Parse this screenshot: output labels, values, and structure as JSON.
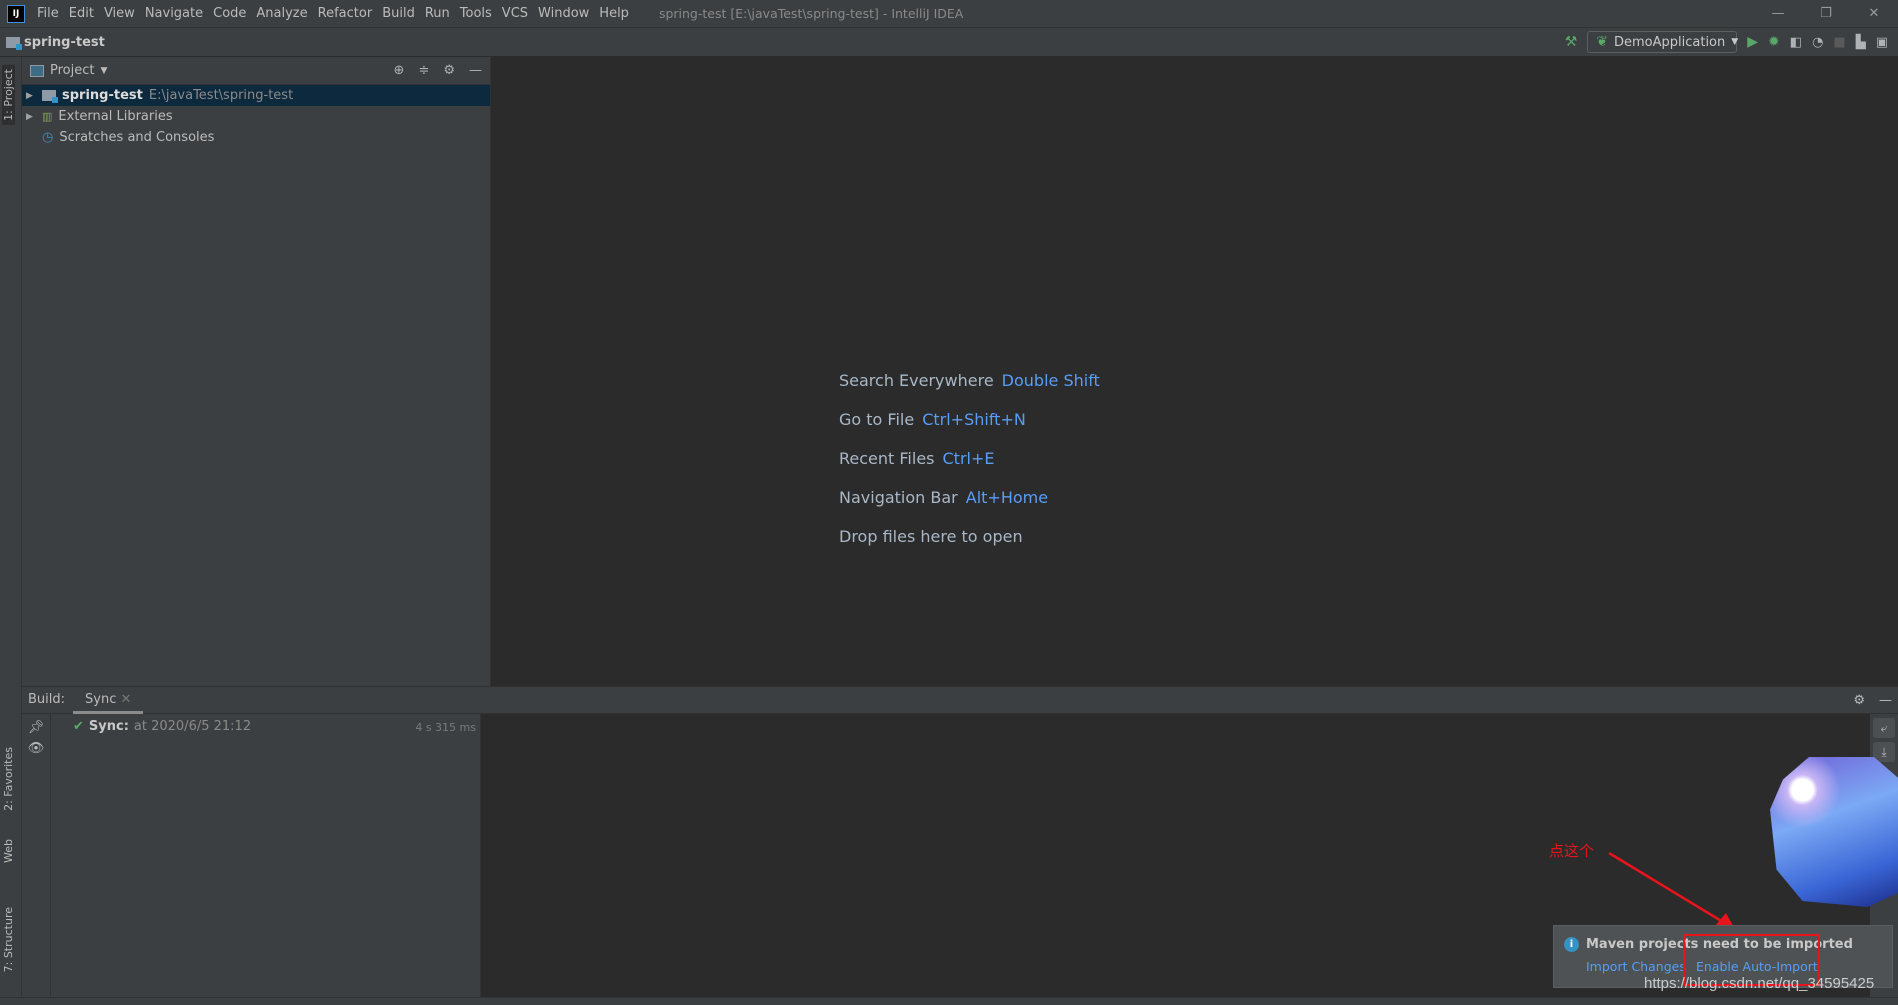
{
  "window": {
    "title": "spring-test [E:\\javaTest\\spring-test] - IntelliJ IDEA",
    "logo": "IJ"
  },
  "menu": [
    "File",
    "Edit",
    "View",
    "Navigate",
    "Code",
    "Analyze",
    "Refactor",
    "Build",
    "Run",
    "Tools",
    "VCS",
    "Window",
    "Help"
  ],
  "navbar": {
    "project": "spring-test",
    "run_config": "DemoApplication"
  },
  "left_tabs": {
    "project": "1: Project",
    "favorites": "2: Favorites",
    "web": "Web",
    "structure": "7: Structure"
  },
  "project_panel": {
    "title": "Project",
    "items": [
      {
        "label": "spring-test",
        "path": "E:\\javaTest\\spring-test",
        "selected": true
      },
      {
        "label": "External Libraries"
      },
      {
        "label": "Scratches and Consoles"
      }
    ]
  },
  "editor_hints": [
    {
      "label": "Search Everywhere",
      "key": "Double Shift"
    },
    {
      "label": "Go to File",
      "key": "Ctrl+Shift+N"
    },
    {
      "label": "Recent Files",
      "key": "Ctrl+E"
    },
    {
      "label": "Navigation Bar",
      "key": "Alt+Home"
    },
    {
      "label": "Drop files here to open",
      "key": ""
    }
  ],
  "build": {
    "label": "Build:",
    "tab": "Sync",
    "sync_label": "Sync:",
    "sync_time": "at 2020/6/5 21:12",
    "duration": "4 s 315 ms"
  },
  "notification": {
    "title": "Maven projects need to be imported",
    "import_changes": "Import Changes",
    "enable_auto_import": "Enable Auto-Import"
  },
  "annotation": {
    "text": "点这个",
    "color": "#e8141b"
  },
  "watermark": "https://blog.csdn.net/qq_34595425",
  "colors": {
    "accent": "#589df6",
    "success": "#59a869",
    "selection": "#0d293e"
  }
}
